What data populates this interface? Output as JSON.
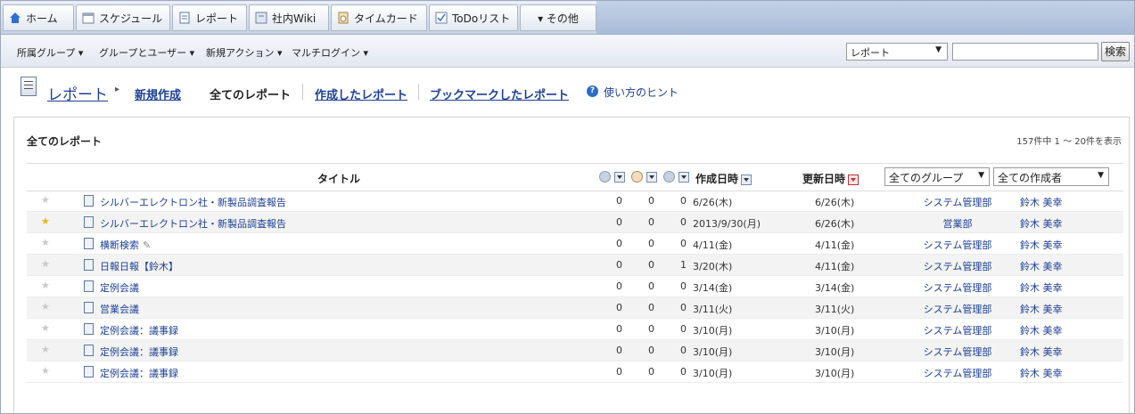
{
  "tabs": [
    {
      "label": "ホーム",
      "icon": "home-icon"
    },
    {
      "label": "スケジュール",
      "icon": "calendar-icon"
    },
    {
      "label": "レポート",
      "icon": "report-icon"
    },
    {
      "label": "社内Wiki",
      "icon": "wiki-icon"
    },
    {
      "label": "タイムカード",
      "icon": "timecard-icon"
    },
    {
      "label": "ToDoリスト",
      "icon": "todo-icon"
    },
    {
      "label": "▾ その他",
      "icon": "more-icon"
    }
  ],
  "subnav": {
    "items": [
      "所属グループ ▾",
      "グループとユーザー ▾",
      "新規アクション ▾",
      "マルチログイン ▾"
    ],
    "search_scope": "レポート",
    "search_value": "",
    "search_button": "検索"
  },
  "breadcrumb": {
    "title": "レポート",
    "sep": "▸",
    "new": "新規作成",
    "all": "全てのレポート",
    "created": "作成したレポート",
    "bookmarked": "ブックマークしたレポート",
    "hint": "使い方のヒント"
  },
  "panel": {
    "title": "全てのレポート",
    "count": "157件中 1 ～ 20件を表示"
  },
  "table": {
    "headers": {
      "title": "タイトル",
      "created": "作成日時",
      "updated": "更新日時",
      "group_filter": "全てのグループ",
      "author_filter": "全ての作成者"
    },
    "rows": [
      {
        "starred": false,
        "title": "シルバーエレクトロン社・新製品調査報告",
        "attach": false,
        "c1": "0",
        "c2": "0",
        "c3": "0",
        "created": "6/26(木)",
        "updated": "6/26(木)",
        "group": "システム管理部",
        "author": "鈴木 美幸"
      },
      {
        "starred": true,
        "title": "シルバーエレクトロン社・新製品調査報告",
        "attach": false,
        "c1": "0",
        "c2": "0",
        "c3": "0",
        "created": "2013/9/30(月)",
        "updated": "6/26(木)",
        "group": "営業部",
        "author": "鈴木 美幸"
      },
      {
        "starred": false,
        "title": "横断検索",
        "attach": true,
        "c1": "0",
        "c2": "0",
        "c3": "0",
        "created": "4/11(金)",
        "updated": "4/11(金)",
        "group": "システム管理部",
        "author": "鈴木 美幸"
      },
      {
        "starred": false,
        "title": "日報日報【鈴木】",
        "attach": false,
        "c1": "0",
        "c2": "0",
        "c3": "1",
        "created": "3/20(木)",
        "updated": "4/11(金)",
        "group": "システム管理部",
        "author": "鈴木 美幸"
      },
      {
        "starred": false,
        "title": "定例会議",
        "attach": false,
        "c1": "0",
        "c2": "0",
        "c3": "0",
        "created": "3/14(金)",
        "updated": "3/14(金)",
        "group": "システム管理部",
        "author": "鈴木 美幸"
      },
      {
        "starred": false,
        "title": "営業会議",
        "attach": false,
        "c1": "0",
        "c2": "0",
        "c3": "0",
        "created": "3/11(火)",
        "updated": "3/11(火)",
        "group": "システム管理部",
        "author": "鈴木 美幸"
      },
      {
        "starred": false,
        "title": "定例会議：議事録",
        "attach": false,
        "c1": "0",
        "c2": "0",
        "c3": "0",
        "created": "3/10(月)",
        "updated": "3/10(月)",
        "group": "システム管理部",
        "author": "鈴木 美幸"
      },
      {
        "starred": false,
        "title": "定例会議：議事録",
        "attach": false,
        "c1": "0",
        "c2": "0",
        "c3": "0",
        "created": "3/10(月)",
        "updated": "3/10(月)",
        "group": "システム管理部",
        "author": "鈴木 美幸"
      },
      {
        "starred": false,
        "title": "定例会議：議事録",
        "attach": false,
        "c1": "0",
        "c2": "0",
        "c3": "0",
        "created": "3/10(月)",
        "updated": "3/10(月)",
        "group": "システム管理部",
        "author": "鈴木 美幸"
      }
    ]
  },
  "colors": {
    "link": "#1c3f94",
    "star_on": "#f0b21a",
    "star_off": "#c9c9c9",
    "tabbar": "#c9d3e3"
  }
}
